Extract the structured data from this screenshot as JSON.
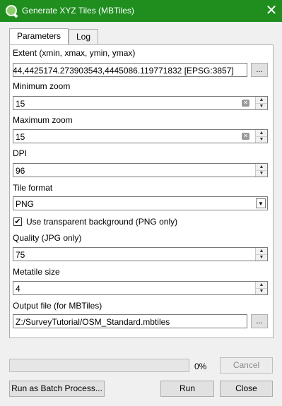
{
  "window": {
    "title": "Generate XYZ Tiles (MBTiles)",
    "close_glyph": "✕"
  },
  "tabs": [
    {
      "label": "Parameters",
      "active": true
    },
    {
      "label": "Log",
      "active": false
    }
  ],
  "form": {
    "extent": {
      "label": "Extent (xmin, xmax, ymin, ymax)",
      "value": "44,4425174.273903543,4445086.119771832 [EPSG:3857]",
      "button": "..."
    },
    "min_zoom": {
      "label": "Minimum zoom",
      "value": "15"
    },
    "max_zoom": {
      "label": "Maximum zoom",
      "value": "15"
    },
    "dpi": {
      "label": "DPI",
      "value": "96"
    },
    "tile_format": {
      "label": "Tile format",
      "value": "PNG"
    },
    "transparent": {
      "label": "Use transparent background (PNG only)",
      "checked": true
    },
    "quality": {
      "label": "Quality (JPG only)",
      "value": "75"
    },
    "metatile": {
      "label": "Metatile size",
      "value": "4"
    },
    "output": {
      "label": "Output file (for MBTiles)",
      "value": "Z:/SurveyTutorial/OSM_Standard.mbtiles",
      "button": "..."
    }
  },
  "progress": {
    "percent": 0,
    "label": "0%"
  },
  "buttons": {
    "cancel": "Cancel",
    "batch": "Run as Batch Process...",
    "run": "Run",
    "close": "Close"
  },
  "colors": {
    "titlebar": "#1f8e1f"
  }
}
